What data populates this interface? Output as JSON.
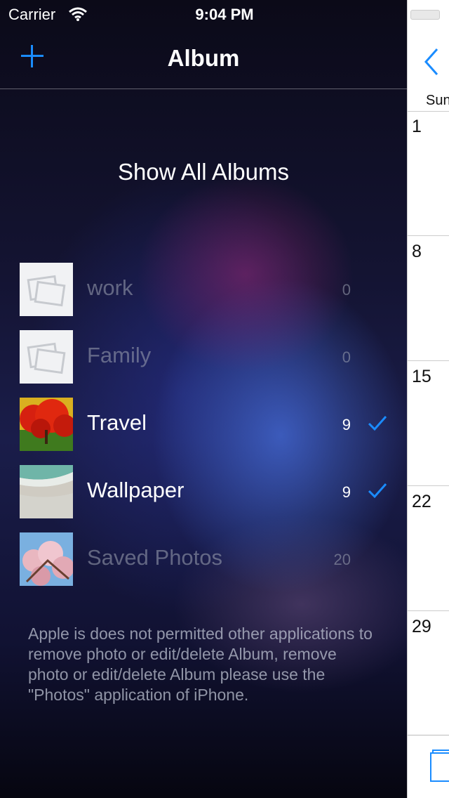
{
  "status_bar": {
    "carrier": "Carrier",
    "time": "9:04 PM"
  },
  "nav": {
    "title": "Album",
    "add_icon": "plus-icon"
  },
  "show_all_label": "Show All Albums",
  "albums": [
    {
      "name": "work",
      "count": "0",
      "selected": false,
      "thumb": "placeholder-photos-icon"
    },
    {
      "name": "Family",
      "count": "0",
      "selected": false,
      "thumb": "placeholder-photos-icon"
    },
    {
      "name": "Travel",
      "count": "9",
      "selected": true,
      "thumb": "red-tree-photo"
    },
    {
      "name": "Wallpaper",
      "count": "9",
      "selected": true,
      "thumb": "beach-photo"
    },
    {
      "name": "Saved Photos",
      "count": "20",
      "selected": false,
      "thumb": "cherry-blossom-photo"
    }
  ],
  "note": "Apple is does not permitted other applications to remove photo or edit/delete Album, remove photo or edit/delete Album please use the \"Photos\" application of iPhone.",
  "calendar": {
    "weekday": "Sun",
    "days": [
      "1",
      "8",
      "15",
      "22",
      "29"
    ],
    "back_icon": "chevron-left-icon"
  },
  "colors": {
    "accent": "#1a8cff",
    "disabled_text": "#6f7384",
    "text": "#ffffff"
  }
}
